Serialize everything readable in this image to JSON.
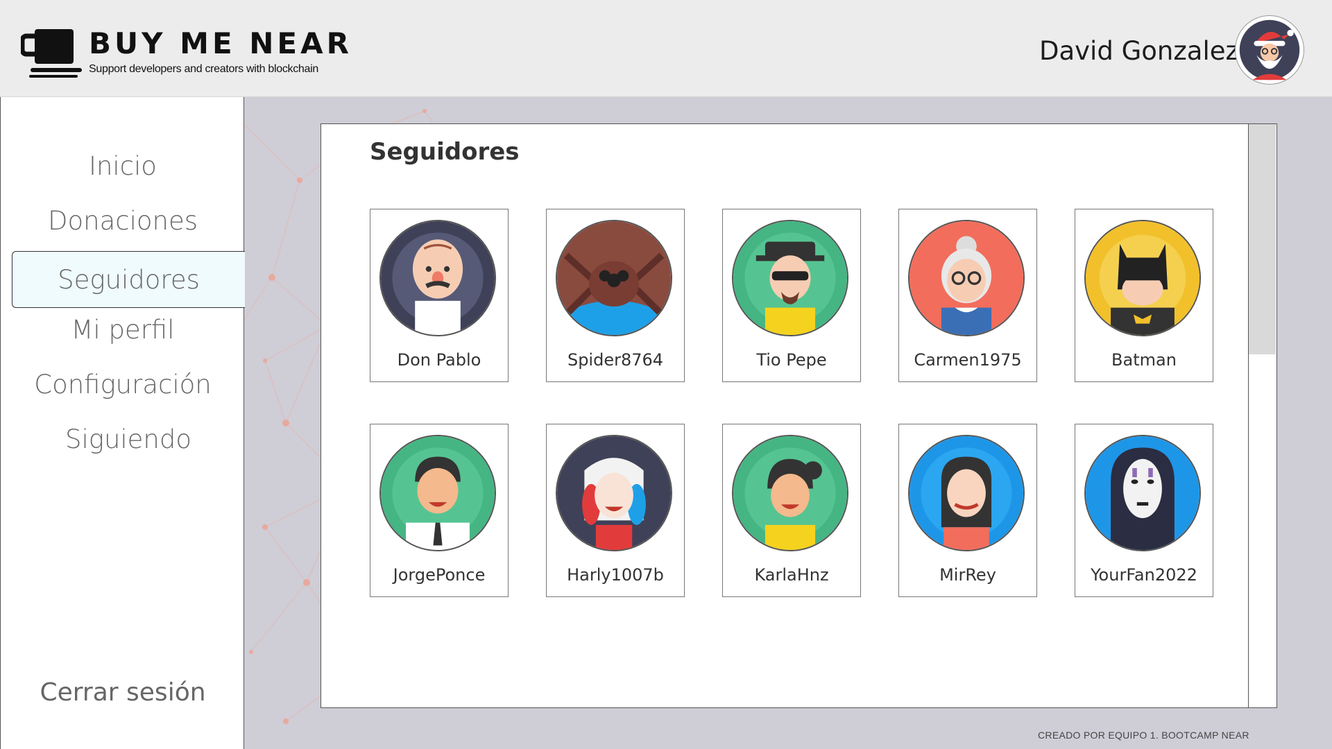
{
  "header": {
    "brand_title": "BUY ME NEAR",
    "brand_subtitle": "Support developers and creators with blockchain",
    "logo_icon": "coffee-cup-icon",
    "user_name": "David Gonzalez",
    "user_avatar_icon": "santa-avatar-icon"
  },
  "sidebar": {
    "items": [
      {
        "label": "Inicio"
      },
      {
        "label": "Donaciones"
      },
      {
        "label": "Seguidores",
        "active": true
      },
      {
        "label": "Mi perfil"
      },
      {
        "label": "Configuración"
      },
      {
        "label": "Siguiendo"
      }
    ],
    "logout_label": "Cerrar sesión"
  },
  "main": {
    "title": "Seguidores",
    "followers": [
      {
        "name": "Don Pablo",
        "bg": "#3f4158",
        "icon": "old-man-avatar-icon"
      },
      {
        "name": "Spider8764",
        "bg": "#1ea0e8",
        "icon": "spider-avatar-icon"
      },
      {
        "name": "Tio Pepe",
        "bg": "#45b583",
        "icon": "heisenberg-avatar-icon"
      },
      {
        "name": "Carmen1975",
        "bg": "#f26d5c",
        "icon": "grandma-avatar-icon"
      },
      {
        "name": "Batman",
        "bg": "#f2c02b",
        "icon": "batman-avatar-icon"
      },
      {
        "name": "JorgePonce",
        "bg": "#45b583",
        "icon": "man-suit-avatar-icon"
      },
      {
        "name": "Harly1007b",
        "bg": "#3f4158",
        "icon": "harley-avatar-icon"
      },
      {
        "name": "KarlaHnz",
        "bg": "#45b583",
        "icon": "girl-avatar-icon"
      },
      {
        "name": "MirRey",
        "bg": "#1e96e8",
        "icon": "woman-wink-avatar-icon"
      },
      {
        "name": "YourFan2022",
        "bg": "#1e96e8",
        "icon": "no-face-avatar-icon"
      }
    ]
  },
  "footer": {
    "credit": "CREADO POR EQUIPO 1. BOOTCAMP NEAR"
  }
}
